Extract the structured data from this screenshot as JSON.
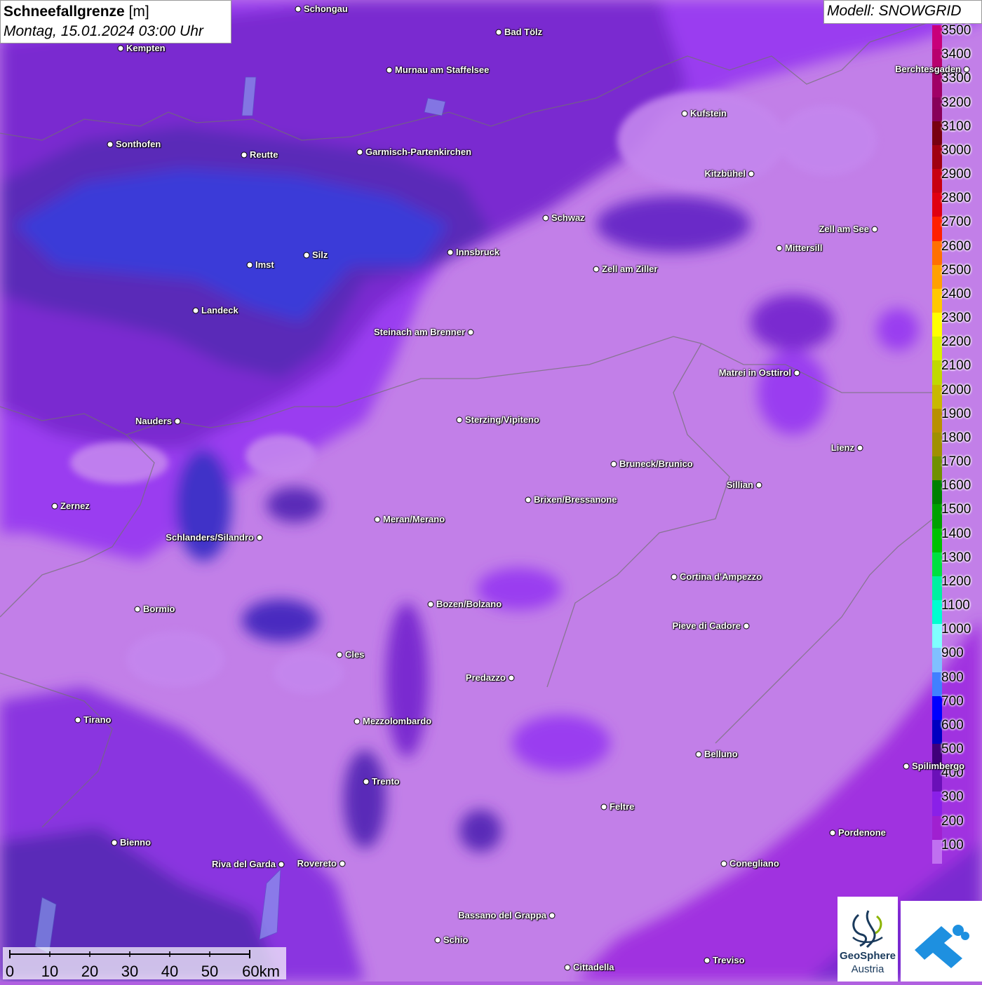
{
  "header": {
    "title": "Schneefallgrenze",
    "unit": "[m]",
    "datetime": "Montag, 15.01.2024 03:00 Uhr",
    "model": "Modell: SNOWGRID"
  },
  "legend": {
    "levels": [
      {
        "label": "3500",
        "color": "#c8007a"
      },
      {
        "label": "3400",
        "color": "#b8006e"
      },
      {
        "label": "3300",
        "color": "#a00066"
      },
      {
        "label": "3200",
        "color": "#88005a"
      },
      {
        "label": "3100",
        "color": "#780010"
      },
      {
        "label": "3000",
        "color": "#a00010"
      },
      {
        "label": "2900",
        "color": "#c80010"
      },
      {
        "label": "2800",
        "color": "#e00010"
      },
      {
        "label": "2700",
        "color": "#ff2000"
      },
      {
        "label": "2600",
        "color": "#ff7000"
      },
      {
        "label": "2500",
        "color": "#ffa000"
      },
      {
        "label": "2400",
        "color": "#ffc800"
      },
      {
        "label": "2300",
        "color": "#ffff00"
      },
      {
        "label": "2200",
        "color": "#d8f000"
      },
      {
        "label": "2100",
        "color": "#c0d800"
      },
      {
        "label": "2000",
        "color": "#c8b800"
      },
      {
        "label": "1900",
        "color": "#b89000"
      },
      {
        "label": "1800",
        "color": "#a09000"
      },
      {
        "label": "1700",
        "color": "#709000"
      },
      {
        "label": "1600",
        "color": "#008000"
      },
      {
        "label": "1500",
        "color": "#00a000"
      },
      {
        "label": "1400",
        "color": "#00c000"
      },
      {
        "label": "1300",
        "color": "#00e040"
      },
      {
        "label": "1200",
        "color": "#00f0a0"
      },
      {
        "label": "1100",
        "color": "#00ffd0"
      },
      {
        "label": "1000",
        "color": "#80ffff"
      },
      {
        "label": "900",
        "color": "#80c0ff"
      },
      {
        "label": "800",
        "color": "#4080ff"
      },
      {
        "label": "700",
        "color": "#0000ff"
      },
      {
        "label": "600",
        "color": "#0000c0"
      },
      {
        "label": "500",
        "color": "#40007a"
      },
      {
        "label": "400",
        "color": "#6a10b8"
      },
      {
        "label": "300",
        "color": "#8a20e8"
      },
      {
        "label": "200",
        "color": "#a020d0"
      },
      {
        "label": "100",
        "color": "#c070f0"
      }
    ]
  },
  "cities": [
    {
      "name": "Schongau"
    },
    {
      "name": "Bad Tölz"
    },
    {
      "name": "Kempten"
    },
    {
      "name": "Murnau am Staffelsee"
    },
    {
      "name": "Berchtesgaden"
    },
    {
      "name": "Kufstein"
    },
    {
      "name": "Sonthofen"
    },
    {
      "name": "Reutte"
    },
    {
      "name": "Garmisch-Partenkirchen"
    },
    {
      "name": "Kitzbühel"
    },
    {
      "name": "Schwaz"
    },
    {
      "name": "Zell am See"
    },
    {
      "name": "Innsbruck"
    },
    {
      "name": "Mittersill"
    },
    {
      "name": "Silz"
    },
    {
      "name": "Imst"
    },
    {
      "name": "Zell am Ziller"
    },
    {
      "name": "Landeck"
    },
    {
      "name": "Steinach am Brenner"
    },
    {
      "name": "Matrei in Osttirol"
    },
    {
      "name": "Nauders"
    },
    {
      "name": "Sterzing/Vipiteno"
    },
    {
      "name": "Lienz"
    },
    {
      "name": "Bruneck/Brunico"
    },
    {
      "name": "Sillian"
    },
    {
      "name": "Brixen/Bressanone"
    },
    {
      "name": "Zernez"
    },
    {
      "name": "Meran/Merano"
    },
    {
      "name": "Schlanders/Silandro"
    },
    {
      "name": "Cortina d'Ampezzo"
    },
    {
      "name": "Bozen/Bolzano"
    },
    {
      "name": "Bormio"
    },
    {
      "name": "Pieve di Cadore"
    },
    {
      "name": "Cles"
    },
    {
      "name": "Predazzo"
    },
    {
      "name": "Tirano"
    },
    {
      "name": "Mezzolombardo"
    },
    {
      "name": "Belluno"
    },
    {
      "name": "Spilimbergo"
    },
    {
      "name": "Trento"
    },
    {
      "name": "Feltre"
    },
    {
      "name": "Pordenone"
    },
    {
      "name": "Bienno"
    },
    {
      "name": "Riva del Garda"
    },
    {
      "name": "Rovereto"
    },
    {
      "name": "Conegliano"
    },
    {
      "name": "Bassano del Grappa"
    },
    {
      "name": "Schio"
    },
    {
      "name": "Treviso"
    },
    {
      "name": "Cittadella"
    }
  ],
  "scale_bar": {
    "labels": [
      "0",
      "10",
      "20",
      "30",
      "40",
      "50",
      "60km"
    ]
  },
  "logos": {
    "geosphere_line1": "GeoSphere",
    "geosphere_line2": "Austria"
  }
}
